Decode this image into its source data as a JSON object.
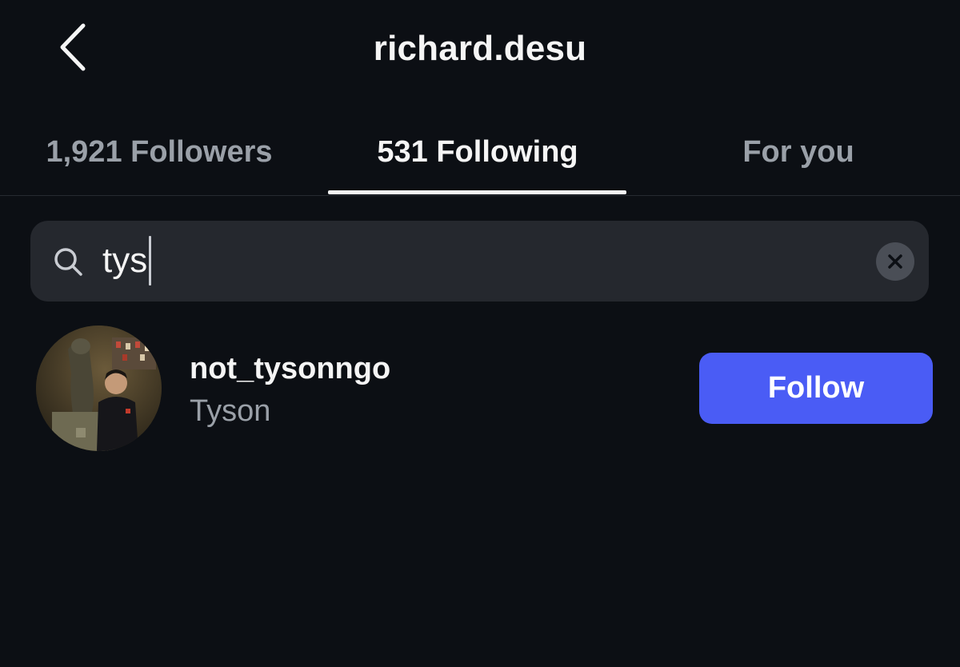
{
  "header": {
    "back_icon": "chevron-left-icon",
    "title": "richard.desu"
  },
  "tabs": [
    {
      "label": "1,921 Followers",
      "active": false
    },
    {
      "label": "531 Following",
      "active": true
    },
    {
      "label": "For you",
      "active": false
    }
  ],
  "search": {
    "icon": "search-icon",
    "value": "tys",
    "clear_icon": "close-icon"
  },
  "results": [
    {
      "username": "not_tysonngo",
      "display_name": "Tyson",
      "button_label": "Follow"
    }
  ],
  "colors": {
    "background": "#0c0f14",
    "search_background": "#25282e",
    "follow_button": "#4a5cf5",
    "text_primary": "#f5f5f5",
    "text_secondary": "#9aa0a8"
  }
}
